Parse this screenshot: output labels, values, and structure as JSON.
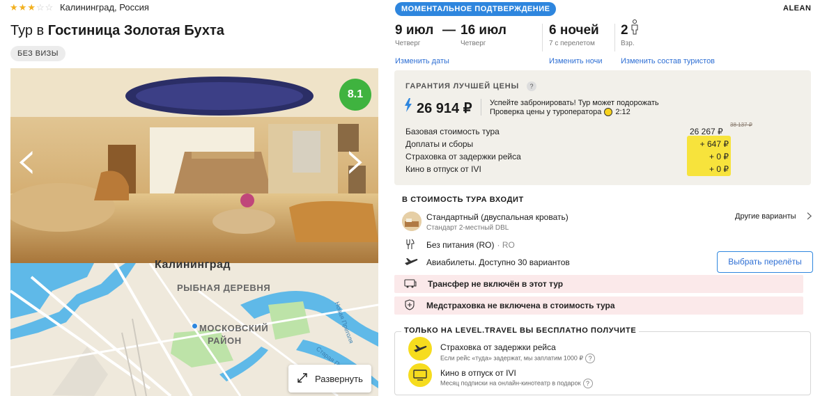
{
  "hotel": {
    "stars": 3,
    "max_stars": 5,
    "location": "Калининград, Россия",
    "title_prefix": "Тур в ",
    "title_name": "Гостиница Золотая Бухта",
    "visa_badge": "БЕЗ ВИЗЫ",
    "rating": "8.1",
    "expand_label": "Развернуть"
  },
  "map": {
    "labels": [
      "Калининград",
      "РЫБНАЯ ДЕРЕВНЯ",
      "МОСКОВСКИЙ",
      "РАЙОН",
      "Новая Преголя",
      "Старая Преголя"
    ]
  },
  "header": {
    "badge": "МОМЕНТАЛЬНОЕ ПОДТВЕРЖДЕНИЕ",
    "operator": "ALEAN"
  },
  "dates": {
    "from": "9 июл",
    "dash": "—",
    "to": "16 июл",
    "from_day": "Четверг",
    "to_day": "Четверг",
    "change_dates": "Изменить даты",
    "nights": "6 ночей",
    "nights_note": "7 с перелетом",
    "change_nights": "Изменить ночи",
    "tourists": "2",
    "tourists_note": "Взр.",
    "change_tourists": "Изменить состав туристов"
  },
  "price": {
    "guarantee": "ГАРАНТИЯ ЛУЧШЕЙ ЦЕНЫ",
    "question": "?",
    "total": "26 914 ₽",
    "hurry": "Успейте забронировать! Тур может подорожать",
    "check": "Проверка цены у туроператора",
    "timer": "2:12",
    "lines": [
      {
        "label": "Базовая стоимость тура",
        "value": "26 267 ₽",
        "old": "38 137 ₽"
      },
      {
        "label": "Доплаты и сборы",
        "value": "+ 647 ₽"
      },
      {
        "label": "Страховка от задержки рейса",
        "value": "+ 0 ₽"
      },
      {
        "label": "Кино в отпуск от IVI",
        "value": "+ 0 ₽"
      }
    ]
  },
  "includes": {
    "heading": "В СТОИМОСТЬ ТУРА ВХОДИТ",
    "room": "Стандартный (двуспальная кровать)",
    "room_sub": "Стандарт 2-местный DBL",
    "other_variants": "Другие варианты",
    "meal": "Без питания (RO)",
    "meal_code": "· RO",
    "flight": "Авиабилеты. Доступно 30 вариантов",
    "choose_flight": "Выбрать перелёты",
    "transfer": "Трансфер не включён в этот тур",
    "insurance": "Медстраховка не включена в стоимость тура"
  },
  "bonus": {
    "heading": "ТОЛЬКО НА LEVEL.TRAVEL ВЫ БЕСПЛАТНО ПОЛУЧИТЕ",
    "items": [
      {
        "title": "Страховка от задержки рейса",
        "sub": "Если рейс «туда» задержат, мы заплатим 1000 ₽"
      },
      {
        "title": "Кино в отпуск от IVI",
        "sub": "Месяц подписки на онлайн-кинотеатр в подарок"
      }
    ]
  },
  "colors": {
    "accent": "#2e86de",
    "rating_green": "#3fb33f",
    "highlight_yellow": "#f7e33c",
    "warning_pink": "#fbe9ea",
    "price_bg": "#f2f0ea"
  }
}
